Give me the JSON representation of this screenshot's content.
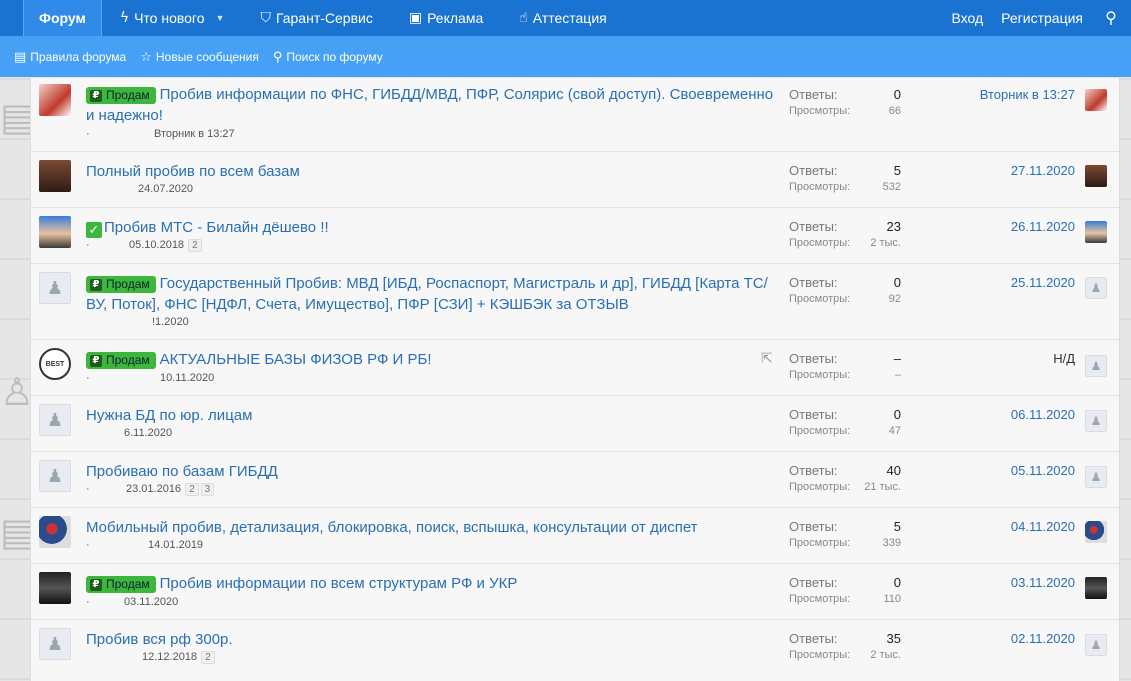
{
  "topnav": {
    "tabs": [
      {
        "label": "Форум",
        "icon": "forum-icon"
      },
      {
        "label": "Что нового",
        "icon": "bolt-icon"
      },
      {
        "label": "Гарант-Сервис",
        "icon": "shield-icon"
      },
      {
        "label": "Реклама",
        "icon": "money-icon"
      },
      {
        "label": "Аттестация",
        "icon": "thumbs-up-icon"
      }
    ],
    "login": "Вход",
    "register": "Регистрация"
  },
  "subnav": {
    "rules": "Правила форума",
    "new_posts": "Новые сообщения",
    "search": "Поиск по форуму"
  },
  "labels": {
    "replies": "Ответы:",
    "views": "Просмотры:",
    "sale_tag": "Продам"
  },
  "threads": [
    {
      "title": "Пробив информации по ФНС, ГИБДД/МВД, ПФР, Солярис (свой доступ). Своевременно и надежно!",
      "tag": true,
      "meta_date": "Вторник в 13:27",
      "replies": "0",
      "views": "66",
      "last": "Вторник в 13:27"
    },
    {
      "title": "Полный пробив по всем базам",
      "tag": false,
      "meta_date": "24.07.2020",
      "replies": "5",
      "views": "532",
      "last": "27.11.2020"
    },
    {
      "title": "Пробив МТС - Билайн дёшево !!",
      "tag": false,
      "check": true,
      "meta_date": "05.10.2018",
      "pages": [
        "2"
      ],
      "replies": "23",
      "views": "2 тыс.",
      "last": "26.11.2020"
    },
    {
      "title": "Государственный Пробив: МВД [ИБД, Роспаспорт, Магистраль и др], ГИБДД [Карта ТС/ВУ, Поток], ФНС [НДФЛ, Счета, Имущество], ПФР [СЗИ] + КЭШБЭК за ОТЗЫВ",
      "tag": true,
      "meta_date": "!1.2020",
      "replies": "0",
      "views": "92",
      "last": "25.11.2020"
    },
    {
      "title": "АКТУАЛЬНЫЕ БАЗЫ ФИЗОВ РФ И РБ!",
      "tag": true,
      "meta_date": "10.11.2020",
      "replies": "–",
      "views": "–",
      "last": "Н/Д"
    },
    {
      "title": "Нужна БД по юр. лицам",
      "tag": false,
      "meta_date": "6.11.2020",
      "replies": "0",
      "views": "47",
      "last": "06.11.2020"
    },
    {
      "title": "Пробиваю по базам ГИБДД",
      "tag": false,
      "meta_date": "23.01.2016",
      "pages": [
        "2",
        "3"
      ],
      "replies": "40",
      "views": "21 тыс.",
      "last": "05.11.2020"
    },
    {
      "title": "Мобильный пробив, детализация, блокировка, поиск, вспышка, консультации от диспет",
      "tag": false,
      "meta_date": "14.01.2019",
      "replies": "5",
      "views": "339",
      "last": "04.11.2020"
    },
    {
      "title": "Пробив информации по всем структурам РФ и УКР",
      "tag": true,
      "meta_date": "03.11.2020",
      "replies": "0",
      "views": "110",
      "last": "03.11.2020"
    },
    {
      "title": "Пробив вся рф 300р.",
      "tag": false,
      "meta_date": "12.12.2018",
      "pages": [
        "2"
      ],
      "replies": "35",
      "views": "2 тыс.",
      "last": "02.11.2020"
    }
  ],
  "colors": {
    "topnav": "#1b73d1",
    "subnav": "#45a0f6",
    "link": "#2a6fb3",
    "tag": "#3cb63c"
  }
}
